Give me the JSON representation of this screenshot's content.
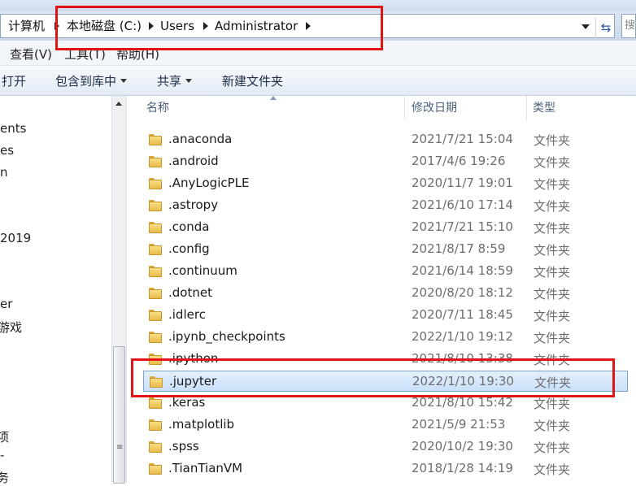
{
  "address": {
    "crumbs": [
      "计算机",
      "本地磁盘 (C:)",
      "Users",
      "Administrator"
    ],
    "refresh_icon": "refresh-icon",
    "search_stub": "搜"
  },
  "menu": {
    "view": "查看(V)",
    "tools": "工具(T)",
    "help": "帮助(H)"
  },
  "toolbar": {
    "open": "打开",
    "include_library": "包含到库中",
    "share": "共享",
    "new_folder": "新建文件夹"
  },
  "nav": {
    "items": [
      "ents",
      "es",
      "n",
      "2019",
      "er",
      "游戏",
      "项",
      "-",
      "务"
    ]
  },
  "columns": {
    "name": "名称",
    "date": "修改日期",
    "type": "类型"
  },
  "files": [
    {
      "name": ".anaconda",
      "date": "2021/7/21 15:04",
      "type": "文件夹"
    },
    {
      "name": ".android",
      "date": "2017/4/6 19:26",
      "type": "文件夹"
    },
    {
      "name": ".AnyLogicPLE",
      "date": "2020/11/7 19:01",
      "type": "文件夹"
    },
    {
      "name": ".astropy",
      "date": "2021/6/10 17:14",
      "type": "文件夹"
    },
    {
      "name": ".conda",
      "date": "2021/7/21 15:10",
      "type": "文件夹"
    },
    {
      "name": ".config",
      "date": "2021/8/17 8:59",
      "type": "文件夹"
    },
    {
      "name": ".continuum",
      "date": "2021/6/14 18:59",
      "type": "文件夹"
    },
    {
      "name": ".dotnet",
      "date": "2020/8/20 18:12",
      "type": "文件夹"
    },
    {
      "name": ".idlerc",
      "date": "2020/7/11 18:45",
      "type": "文件夹"
    },
    {
      "name": ".ipynb_checkpoints",
      "date": "2022/1/10 19:12",
      "type": "文件夹"
    },
    {
      "name": ".ipython",
      "date": "2021/8/10 13:38",
      "type": "文件夹"
    },
    {
      "name": ".jupyter",
      "date": "2022/1/10 19:30",
      "type": "文件夹",
      "selected": true
    },
    {
      "name": ".keras",
      "date": "2021/8/10 15:42",
      "type": "文件夹"
    },
    {
      "name": ".matplotlib",
      "date": "2021/5/9 21:53",
      "type": "文件夹"
    },
    {
      "name": ".spss",
      "date": "2020/10/2 19:30",
      "type": "文件夹"
    },
    {
      "name": ".TianTianVM",
      "date": "2018/1/28 14:19",
      "type": "文件夹"
    }
  ],
  "colors": {
    "highlight_box": "#e01414",
    "selection": "#c9e0fa"
  }
}
